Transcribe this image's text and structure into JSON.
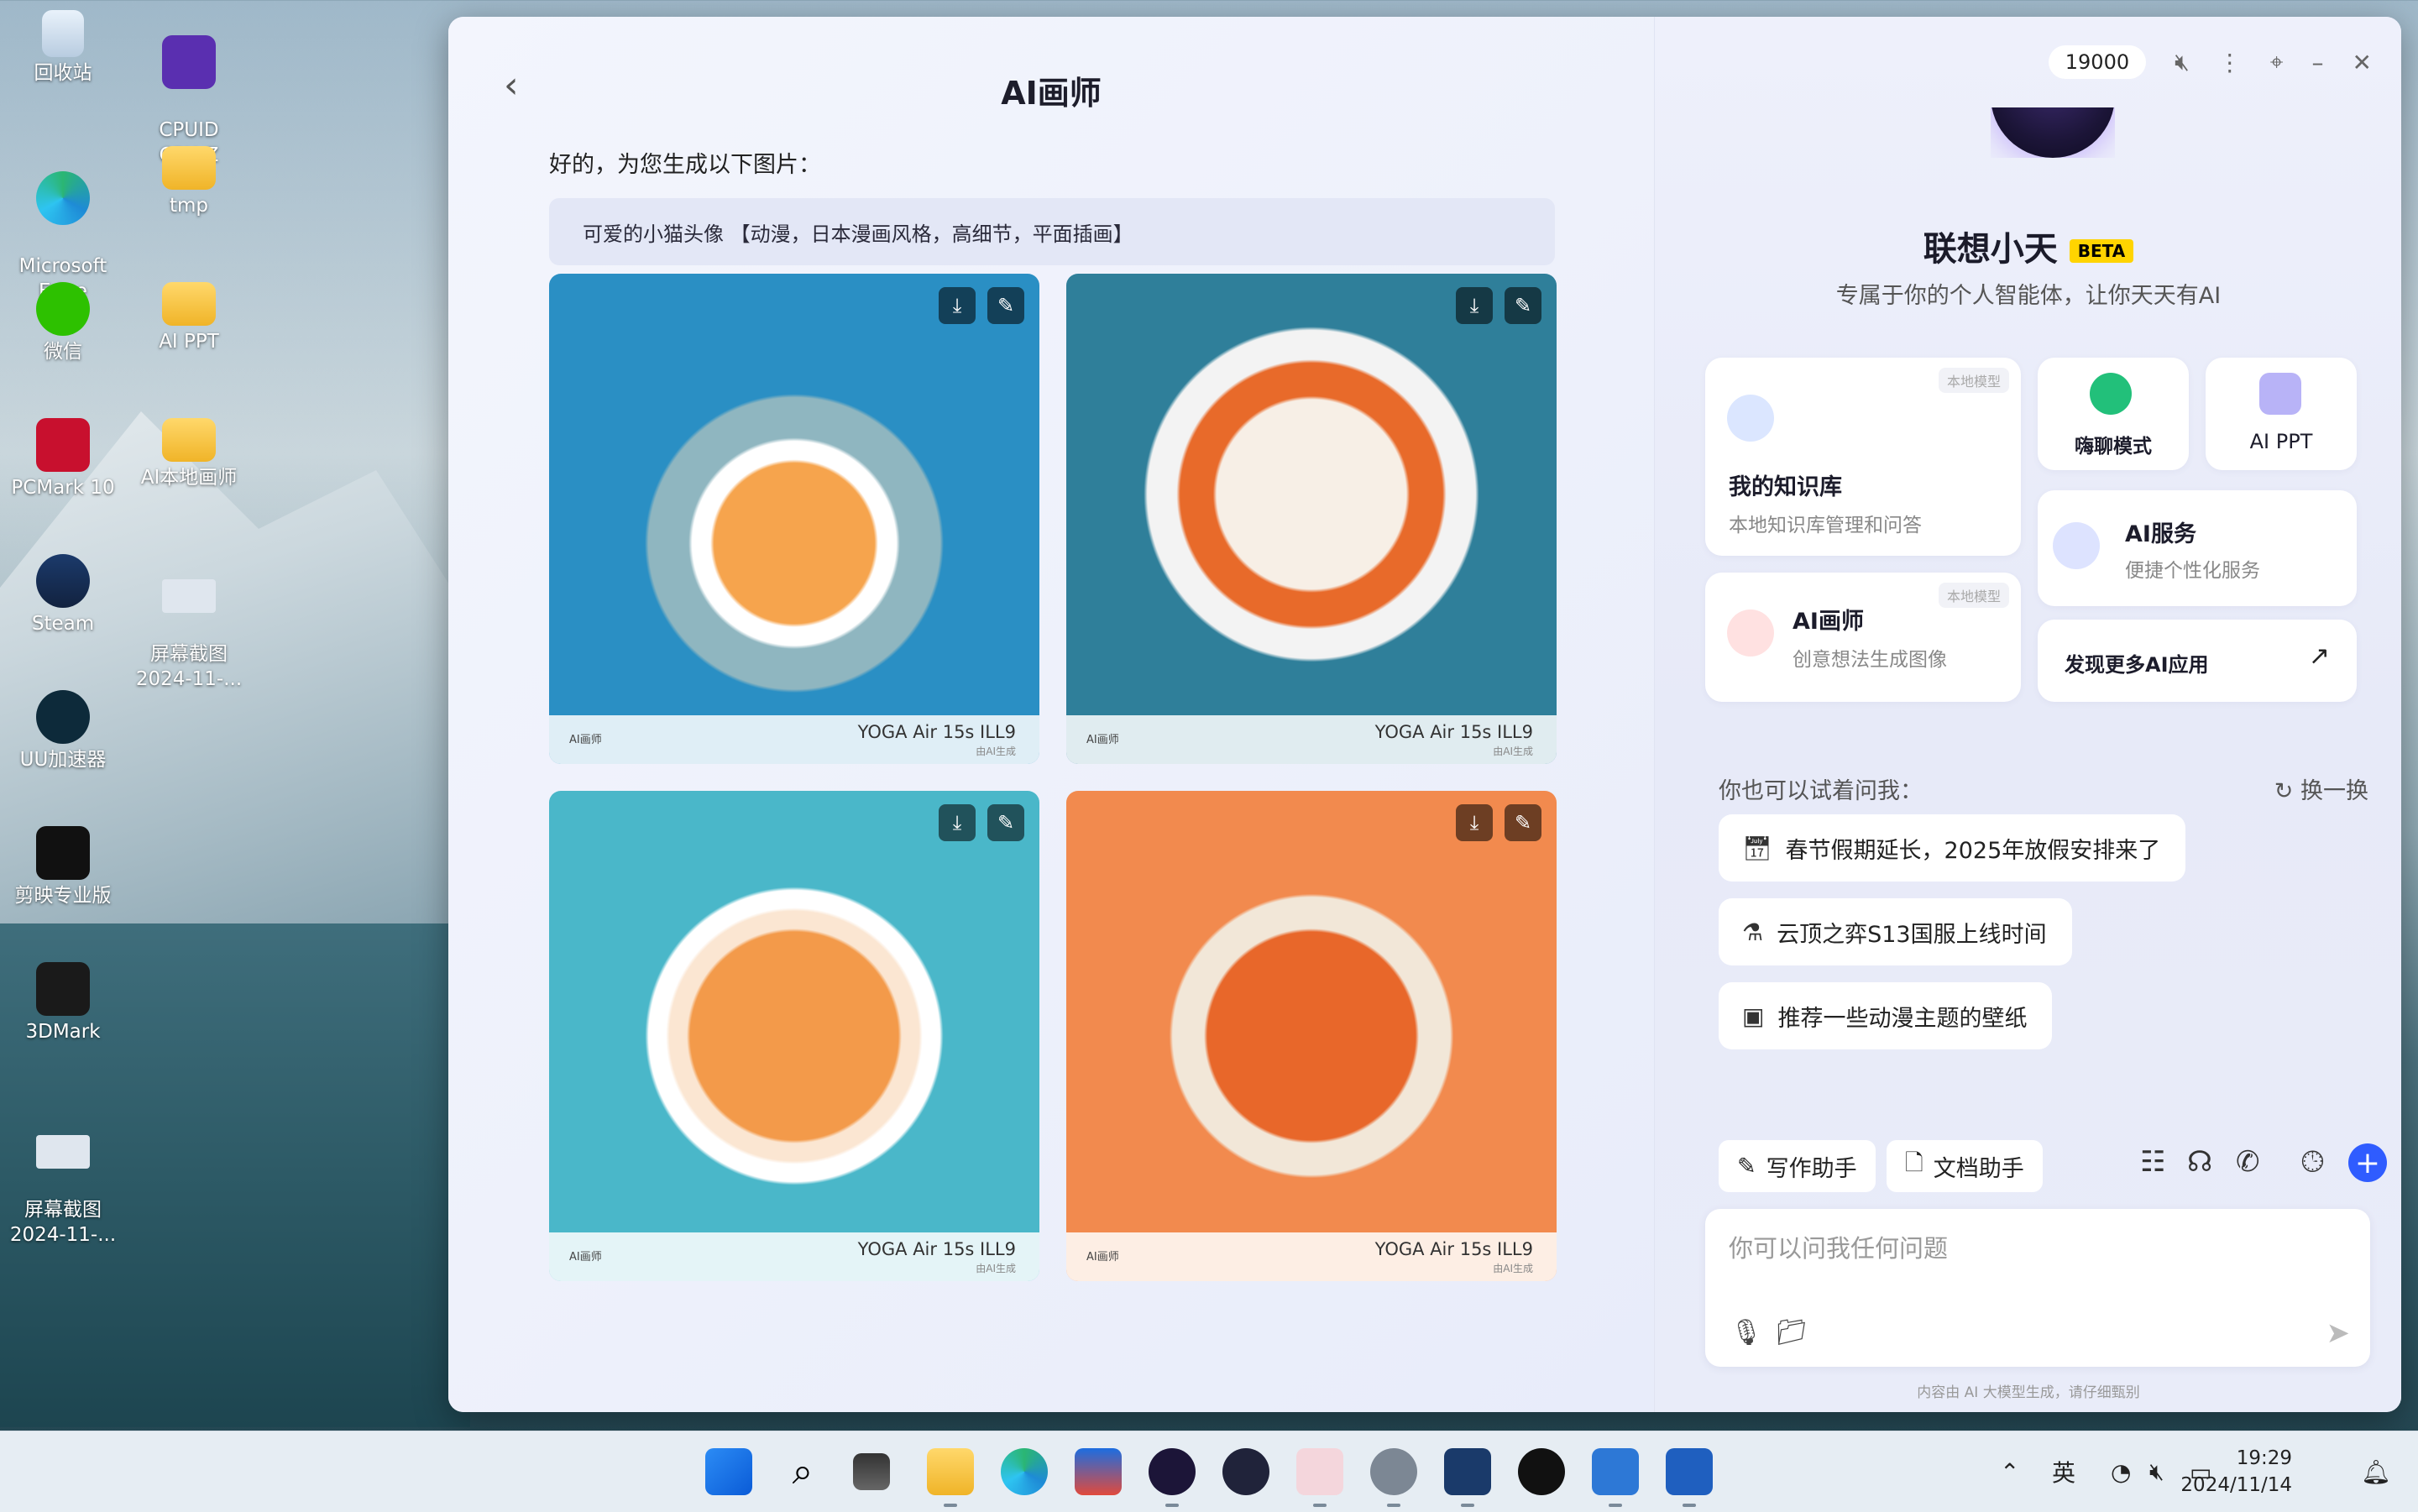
{
  "desktop": {
    "icons": [
      {
        "label": "回收站"
      },
      {
        "label": "CPUID\nCPU-Z"
      },
      {
        "label": "Microsoft\nEdge"
      },
      {
        "label": "tmp"
      },
      {
        "label": "微信"
      },
      {
        "label": "AI PPT"
      },
      {
        "label": "PCMark 10"
      },
      {
        "label": "AI本地画师"
      },
      {
        "label": "Steam"
      },
      {
        "label": "屏幕截图\n2024-11-..."
      },
      {
        "label": "UU加速器"
      },
      {
        "label": "剪映专业版"
      },
      {
        "label": "3DMark"
      },
      {
        "label": "屏幕截图\n2024-11-..."
      }
    ]
  },
  "chat": {
    "title": "AI画师",
    "intro": "好的，为您生成以下图片：",
    "prompt": "可爱的小猫头像 【动漫，日本漫画风格，高细节，平面插画】",
    "image_watermark": {
      "logo": "AI画师",
      "device": "YOGA Air 15s ILL9",
      "sub": "由AI生成"
    },
    "images": [
      {
        "name": "cat-astronaut"
      },
      {
        "name": "cat-headphones"
      },
      {
        "name": "cat-blue-clouds"
      },
      {
        "name": "cat-orange-sun"
      }
    ]
  },
  "assistant": {
    "credits": "19000",
    "name": "联想小天",
    "beta": "BETA",
    "tagline": "专属于你的个人智能体，让你天天有AI",
    "cards": {
      "knowledge": {
        "title": "我的知识库",
        "desc": "本地知识库管理和问答",
        "badge": "本地模型"
      },
      "chat_mode": {
        "title": "嗨聊模式"
      },
      "ai_ppt": {
        "title": "AI PPT"
      },
      "ai_service": {
        "title": "AI服务",
        "desc": "便捷个性化服务"
      },
      "ai_painter": {
        "title": "AI画师",
        "desc": "创意想法生成图像",
        "badge": "本地模型"
      },
      "discover": {
        "title": "发现更多AI应用"
      }
    },
    "ask_label": "你也可以试着问我：",
    "refresh": "换一换",
    "suggestions": [
      "春节假期延长，2025年放假安排来了",
      "云顶之弈S13国服上线时间",
      "推荐一些动漫主题的壁纸"
    ],
    "chips": {
      "writing": "写作助手",
      "docs": "文档助手"
    },
    "input_placeholder": "你可以问我任何问题",
    "disclaimer": "内容由 AI 大模型生成，请仔细甄别"
  },
  "taskbar": {
    "ime": "英",
    "time": "19:29",
    "date": "2024/11/14"
  },
  "colors": {
    "accent": "#2f5cff",
    "beta": "#ffd400"
  }
}
